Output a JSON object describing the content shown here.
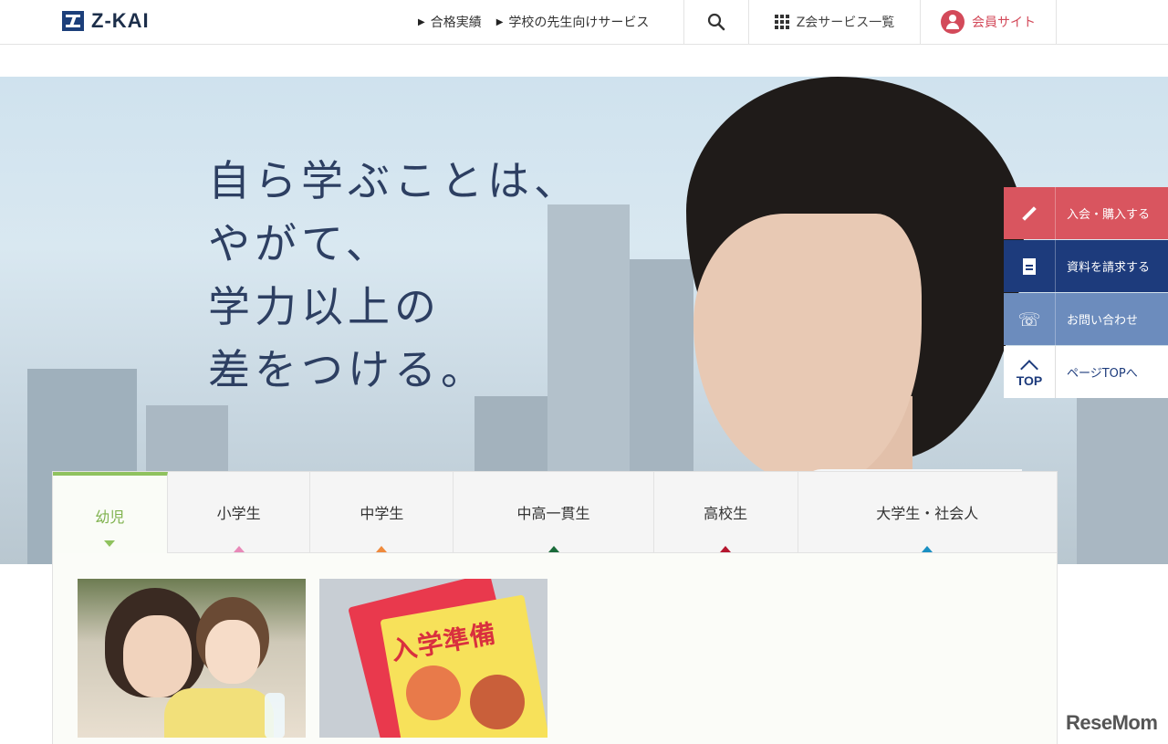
{
  "header": {
    "logo_text": "Z-KAI",
    "nav_links": [
      {
        "label": "合格実績"
      },
      {
        "label": "学校の先生向けサービス"
      }
    ],
    "services_label": "Z会サービス一覧",
    "member_label": "会員サイト"
  },
  "hero": {
    "copy_lines": [
      "自ら学ぶことは、",
      "やがて、",
      "学力以上の",
      "差をつける。"
    ]
  },
  "side_actions": [
    {
      "label": "入会・購入する",
      "icon": "pencil-icon",
      "color": "#d9555f"
    },
    {
      "label": "資料を請求する",
      "icon": "document-icon",
      "color": "#1d3b7c"
    },
    {
      "label": "お問い合わせ",
      "icon": "phone-icon",
      "color": "#6c8cbd"
    },
    {
      "label": "ページTOPへ",
      "icon_text": "TOP",
      "icon": "chevron-up-icon",
      "color": "#ffffff"
    }
  ],
  "tabs": [
    {
      "label": "幼児",
      "active": true,
      "color": "#8fc25e"
    },
    {
      "label": "小学生",
      "active": false,
      "color": "#e889b8"
    },
    {
      "label": "中学生",
      "active": false,
      "color": "#ef8a3c"
    },
    {
      "label": "中高一貫生",
      "active": false,
      "color": "#1b6b3a"
    },
    {
      "label": "高校生",
      "active": false,
      "color": "#b5172e"
    },
    {
      "label": "大学生・社会人",
      "active": false,
      "color": "#1a8fc2"
    }
  ],
  "cards": [
    {
      "image": "mother-and-child-photo"
    },
    {
      "image": "nyugaku-junbi-workbook-photo",
      "book_title": "入学準備"
    }
  ],
  "watermark": "ReseMom"
}
